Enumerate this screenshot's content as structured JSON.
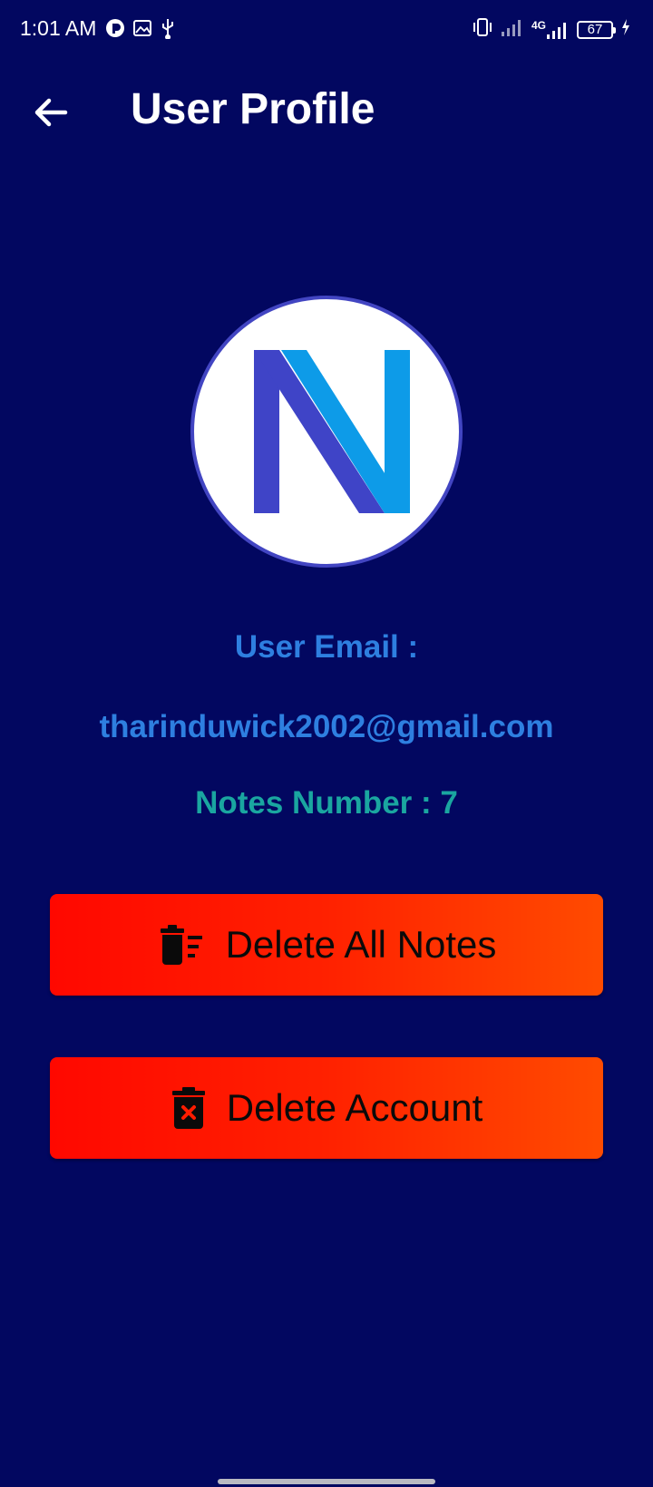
{
  "status_bar": {
    "time": "1:01 AM",
    "network": "4G",
    "battery": "67",
    "left_icons": [
      "notification-app-icon",
      "image-icon",
      "usb-icon"
    ],
    "right_icons": [
      "vibrate-icon",
      "signal-icon",
      "signal-4g-icon",
      "battery-icon",
      "charging-icon"
    ]
  },
  "app_bar": {
    "title": "User Profile",
    "back_icon": "arrow-back-icon"
  },
  "profile": {
    "avatar_logo": "N",
    "colors": {
      "avatar_border": "#4245c2",
      "logo_dark": "#3f44c7",
      "logo_light": "#0d9be8"
    },
    "email_label": "User Email :",
    "email": "tharinduwick2002@gmail.com",
    "notes_label": "Notes Number :",
    "notes_count": "7"
  },
  "actions": {
    "delete_all_notes": {
      "label": "Delete All Notes",
      "icon": "delete-sweep-icon"
    },
    "delete_account": {
      "label": "Delete Account",
      "icon": "delete-forever-icon"
    }
  },
  "theme": {
    "background": "#020760",
    "email_color": "#2e7fe0",
    "notes_color": "#1aa6a0",
    "button_gradient_start": "#ff0800",
    "button_gradient_end": "#ff4b00"
  }
}
